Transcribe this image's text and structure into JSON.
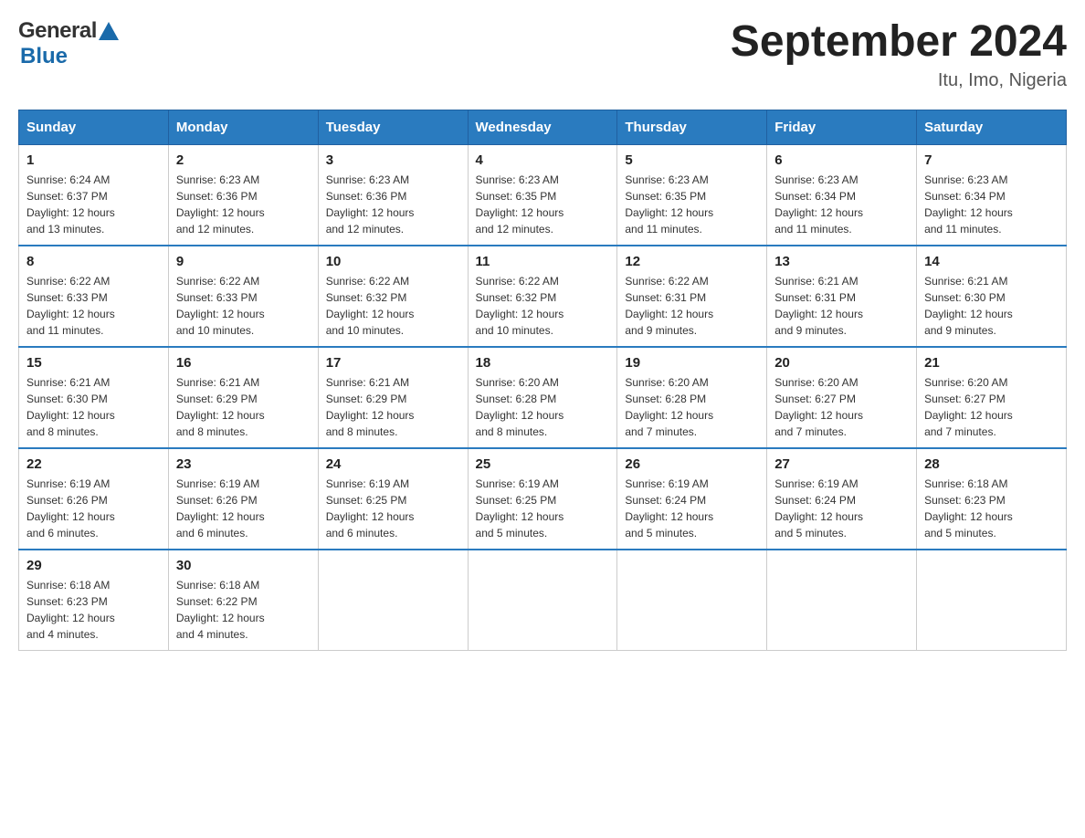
{
  "logo": {
    "general": "General",
    "blue": "Blue"
  },
  "title": "September 2024",
  "subtitle": "Itu, Imo, Nigeria",
  "columns": [
    "Sunday",
    "Monday",
    "Tuesday",
    "Wednesday",
    "Thursday",
    "Friday",
    "Saturday"
  ],
  "weeks": [
    [
      {
        "day": "1",
        "info": "Sunrise: 6:24 AM\nSunset: 6:37 PM\nDaylight: 12 hours\nand 13 minutes."
      },
      {
        "day": "2",
        "info": "Sunrise: 6:23 AM\nSunset: 6:36 PM\nDaylight: 12 hours\nand 12 minutes."
      },
      {
        "day": "3",
        "info": "Sunrise: 6:23 AM\nSunset: 6:36 PM\nDaylight: 12 hours\nand 12 minutes."
      },
      {
        "day": "4",
        "info": "Sunrise: 6:23 AM\nSunset: 6:35 PM\nDaylight: 12 hours\nand 12 minutes."
      },
      {
        "day": "5",
        "info": "Sunrise: 6:23 AM\nSunset: 6:35 PM\nDaylight: 12 hours\nand 11 minutes."
      },
      {
        "day": "6",
        "info": "Sunrise: 6:23 AM\nSunset: 6:34 PM\nDaylight: 12 hours\nand 11 minutes."
      },
      {
        "day": "7",
        "info": "Sunrise: 6:23 AM\nSunset: 6:34 PM\nDaylight: 12 hours\nand 11 minutes."
      }
    ],
    [
      {
        "day": "8",
        "info": "Sunrise: 6:22 AM\nSunset: 6:33 PM\nDaylight: 12 hours\nand 11 minutes."
      },
      {
        "day": "9",
        "info": "Sunrise: 6:22 AM\nSunset: 6:33 PM\nDaylight: 12 hours\nand 10 minutes."
      },
      {
        "day": "10",
        "info": "Sunrise: 6:22 AM\nSunset: 6:32 PM\nDaylight: 12 hours\nand 10 minutes."
      },
      {
        "day": "11",
        "info": "Sunrise: 6:22 AM\nSunset: 6:32 PM\nDaylight: 12 hours\nand 10 minutes."
      },
      {
        "day": "12",
        "info": "Sunrise: 6:22 AM\nSunset: 6:31 PM\nDaylight: 12 hours\nand 9 minutes."
      },
      {
        "day": "13",
        "info": "Sunrise: 6:21 AM\nSunset: 6:31 PM\nDaylight: 12 hours\nand 9 minutes."
      },
      {
        "day": "14",
        "info": "Sunrise: 6:21 AM\nSunset: 6:30 PM\nDaylight: 12 hours\nand 9 minutes."
      }
    ],
    [
      {
        "day": "15",
        "info": "Sunrise: 6:21 AM\nSunset: 6:30 PM\nDaylight: 12 hours\nand 8 minutes."
      },
      {
        "day": "16",
        "info": "Sunrise: 6:21 AM\nSunset: 6:29 PM\nDaylight: 12 hours\nand 8 minutes."
      },
      {
        "day": "17",
        "info": "Sunrise: 6:21 AM\nSunset: 6:29 PM\nDaylight: 12 hours\nand 8 minutes."
      },
      {
        "day": "18",
        "info": "Sunrise: 6:20 AM\nSunset: 6:28 PM\nDaylight: 12 hours\nand 8 minutes."
      },
      {
        "day": "19",
        "info": "Sunrise: 6:20 AM\nSunset: 6:28 PM\nDaylight: 12 hours\nand 7 minutes."
      },
      {
        "day": "20",
        "info": "Sunrise: 6:20 AM\nSunset: 6:27 PM\nDaylight: 12 hours\nand 7 minutes."
      },
      {
        "day": "21",
        "info": "Sunrise: 6:20 AM\nSunset: 6:27 PM\nDaylight: 12 hours\nand 7 minutes."
      }
    ],
    [
      {
        "day": "22",
        "info": "Sunrise: 6:19 AM\nSunset: 6:26 PM\nDaylight: 12 hours\nand 6 minutes."
      },
      {
        "day": "23",
        "info": "Sunrise: 6:19 AM\nSunset: 6:26 PM\nDaylight: 12 hours\nand 6 minutes."
      },
      {
        "day": "24",
        "info": "Sunrise: 6:19 AM\nSunset: 6:25 PM\nDaylight: 12 hours\nand 6 minutes."
      },
      {
        "day": "25",
        "info": "Sunrise: 6:19 AM\nSunset: 6:25 PM\nDaylight: 12 hours\nand 5 minutes."
      },
      {
        "day": "26",
        "info": "Sunrise: 6:19 AM\nSunset: 6:24 PM\nDaylight: 12 hours\nand 5 minutes."
      },
      {
        "day": "27",
        "info": "Sunrise: 6:19 AM\nSunset: 6:24 PM\nDaylight: 12 hours\nand 5 minutes."
      },
      {
        "day": "28",
        "info": "Sunrise: 6:18 AM\nSunset: 6:23 PM\nDaylight: 12 hours\nand 5 minutes."
      }
    ],
    [
      {
        "day": "29",
        "info": "Sunrise: 6:18 AM\nSunset: 6:23 PM\nDaylight: 12 hours\nand 4 minutes."
      },
      {
        "day": "30",
        "info": "Sunrise: 6:18 AM\nSunset: 6:22 PM\nDaylight: 12 hours\nand 4 minutes."
      },
      {
        "day": "",
        "info": ""
      },
      {
        "day": "",
        "info": ""
      },
      {
        "day": "",
        "info": ""
      },
      {
        "day": "",
        "info": ""
      },
      {
        "day": "",
        "info": ""
      }
    ]
  ]
}
